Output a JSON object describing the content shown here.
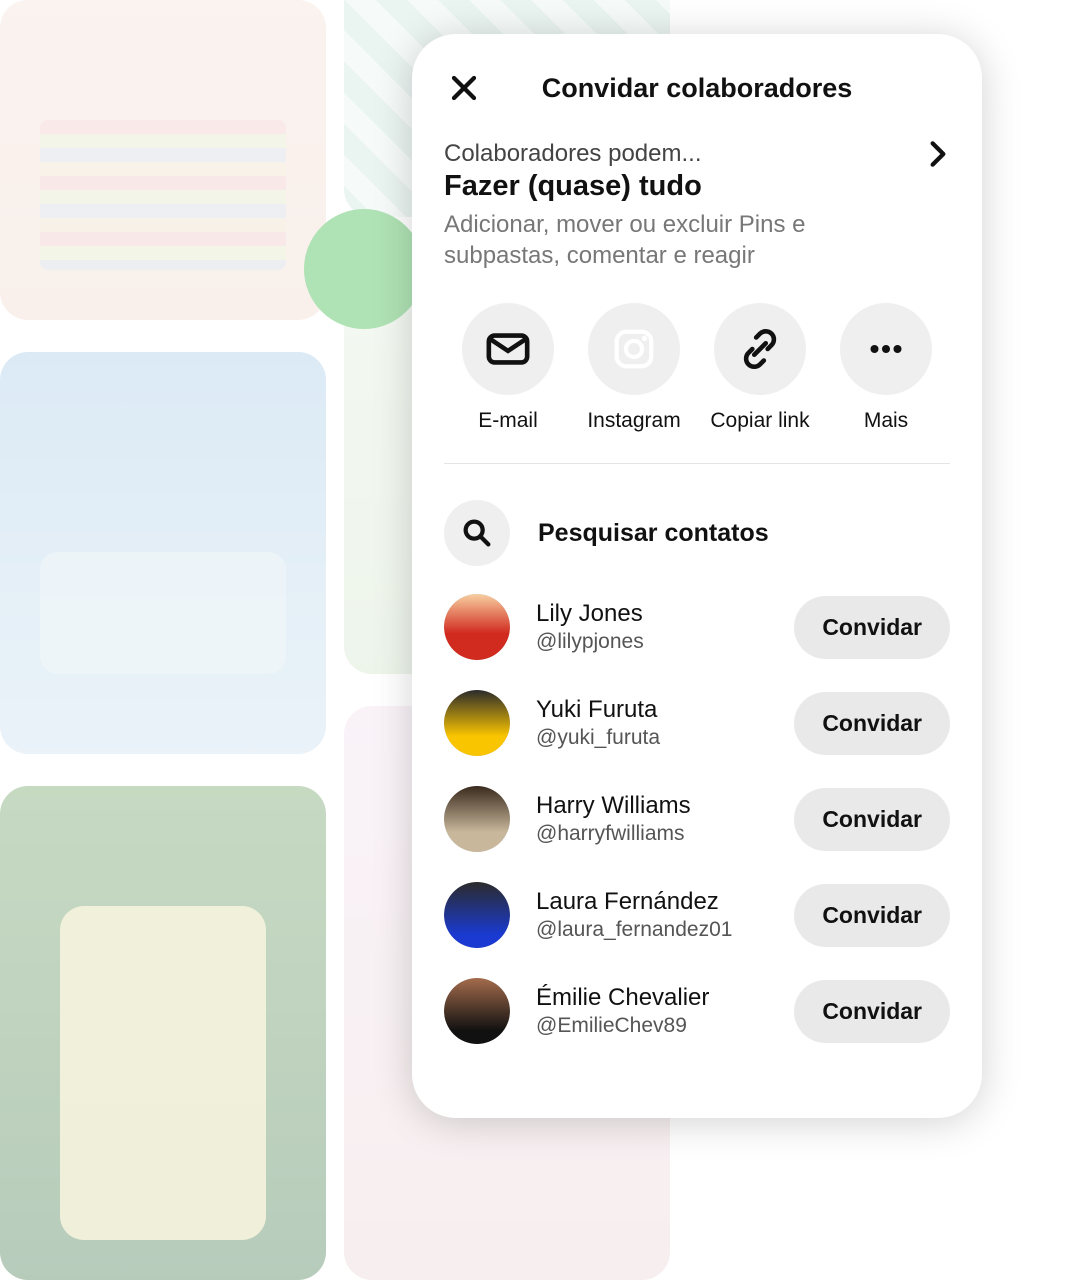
{
  "modal": {
    "title": "Convidar colaboradores",
    "permissions": {
      "label": "Colaboradores podem...",
      "heading": "Fazer (quase) tudo",
      "description": "Adicionar, mover ou excluir Pins e subpastas, comentar e reagir"
    },
    "share": {
      "email": "E-mail",
      "instagram": "Instagram",
      "copy_link": "Copiar link",
      "more": "Mais"
    },
    "search_placeholder": "Pesquisar contatos",
    "invite_label": "Convidar"
  },
  "contacts": [
    {
      "name": "Lily Jones",
      "handle": "@lilypjones"
    },
    {
      "name": "Yuki Furuta",
      "handle": "@yuki_furuta"
    },
    {
      "name": "Harry Williams",
      "handle": "@harryfwilliams"
    },
    {
      "name": "Laura Fernández",
      "handle": "@laura_fernandez01"
    },
    {
      "name": "Émilie Chevalier",
      "handle": "@EmilieChev89"
    }
  ]
}
